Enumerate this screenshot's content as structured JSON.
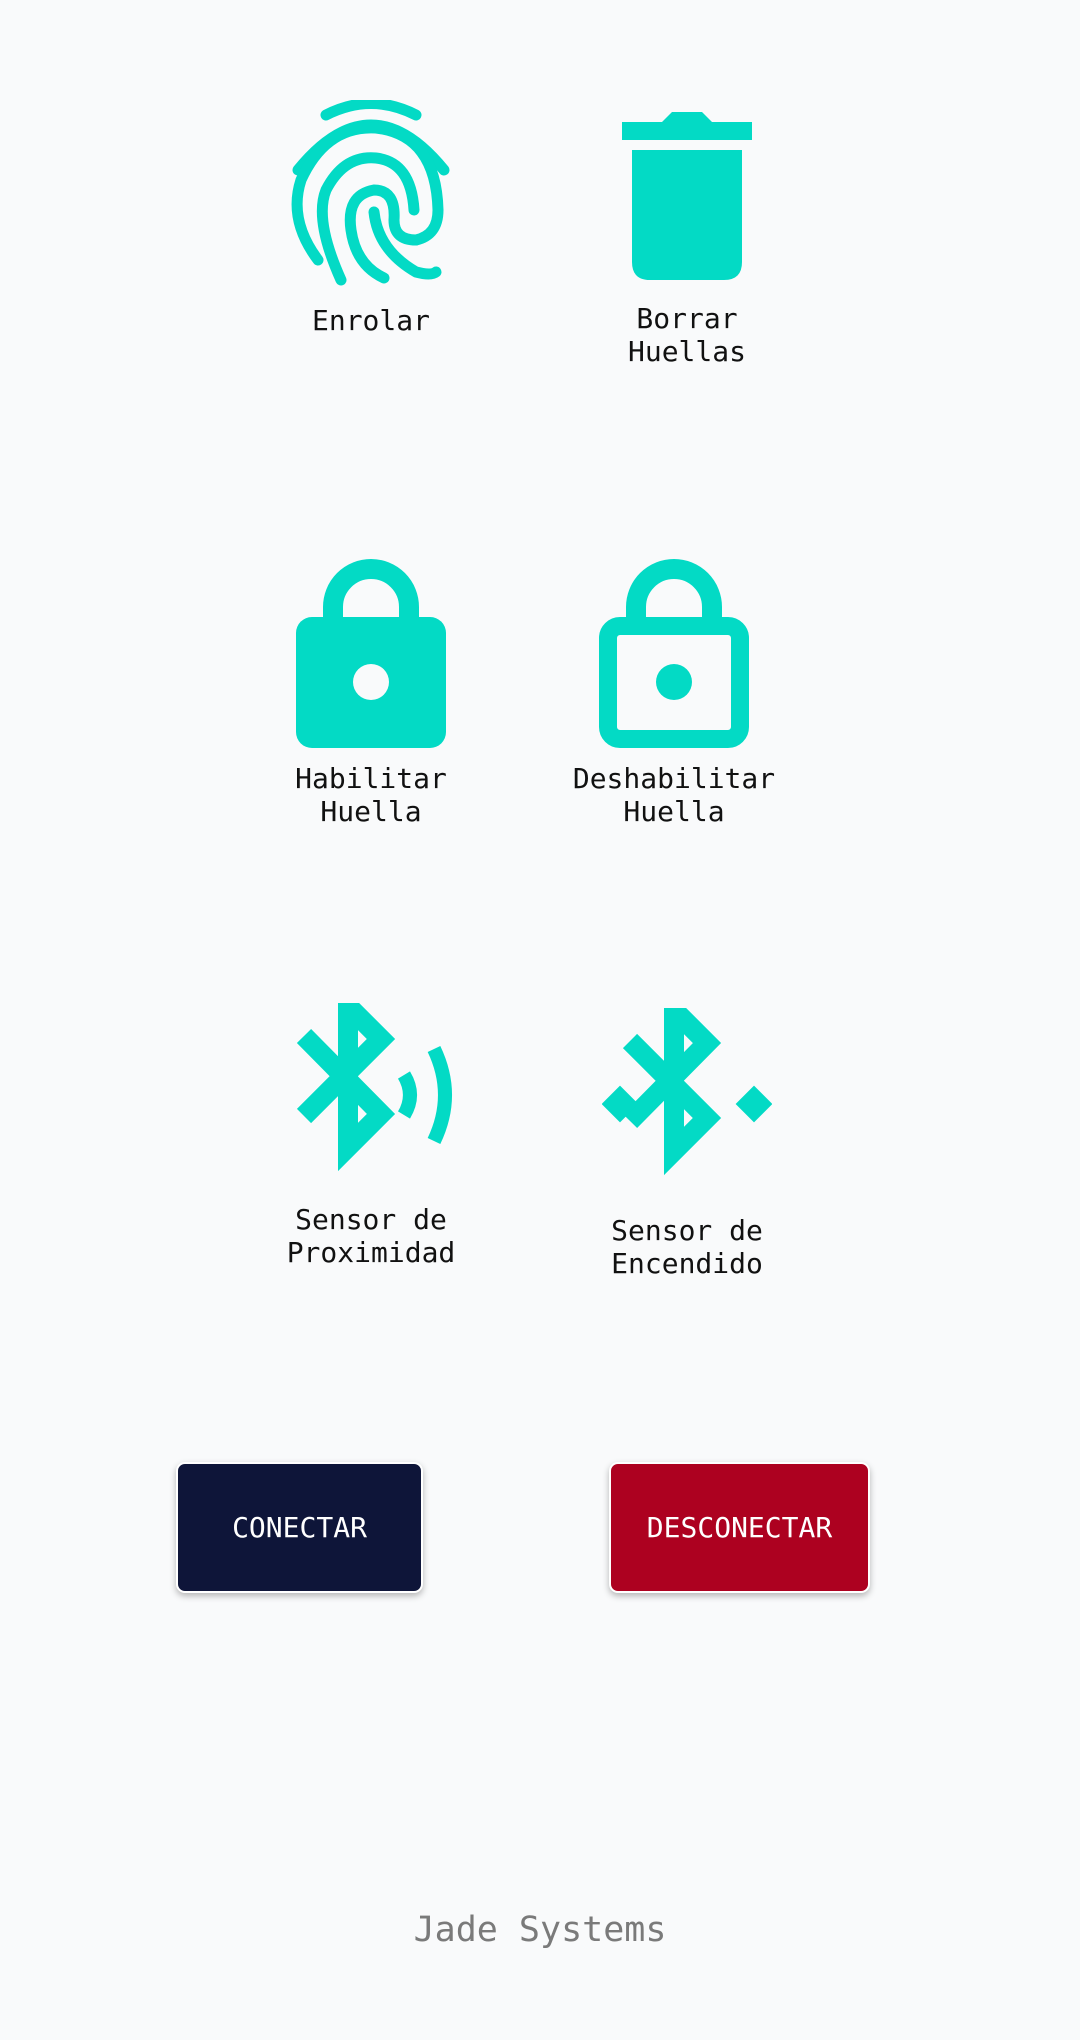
{
  "accent_color": "#03dac5",
  "actions": {
    "enroll": {
      "icon": "fingerprint-icon",
      "lines": [
        "Enrolar"
      ]
    },
    "delete": {
      "icon": "trash-icon",
      "lines": [
        "Borrar",
        "Huellas"
      ]
    },
    "enable": {
      "icon": "lock-closed-icon",
      "lines": [
        "Habilitar",
        "Huella"
      ]
    },
    "disable": {
      "icon": "lock-open-icon",
      "lines": [
        "Deshabilitar",
        "Huella"
      ]
    },
    "proximity": {
      "icon": "bluetooth-audio-icon",
      "lines": [
        "Sensor de",
        "Proximidad"
      ]
    },
    "power": {
      "icon": "bluetooth-connected-icon",
      "lines": [
        "Sensor de",
        "Encendido"
      ]
    }
  },
  "buttons": {
    "connect": {
      "label": "CONECTAR",
      "color": "#0e1539"
    },
    "disconnect": {
      "label": "DESCONECTAR",
      "color": "#ad0120"
    }
  },
  "footer": {
    "brand": "Jade Systems"
  }
}
